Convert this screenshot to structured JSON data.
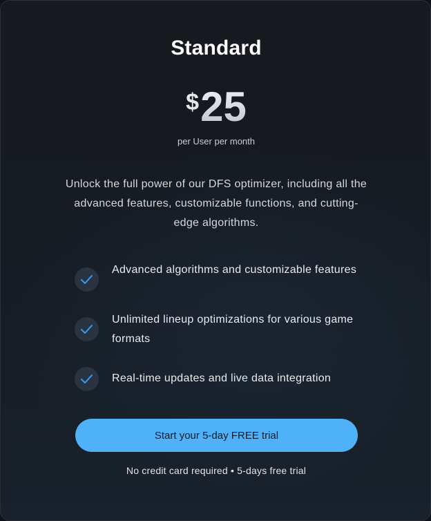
{
  "plan": {
    "title": "Standard",
    "currency": "$",
    "price": "25",
    "period": "per User per month",
    "description": "Unlock the full power of our DFS optimizer, including all the advanced features, customizable functions, and cutting-edge algorithms."
  },
  "features": [
    {
      "text": "Advanced algorithms and customizable features",
      "icon": "check-icon"
    },
    {
      "text": "Unlimited lineup optimizations for various game formats",
      "icon": "check-icon"
    },
    {
      "text": "Real-time updates and live data integration",
      "icon": "check-icon"
    }
  ],
  "cta": {
    "label": "Start your 5-day FREE trial"
  },
  "footnote": "No credit card required • 5-days free trial",
  "colors": {
    "accent": "#4fb1f7",
    "check": "#3b9bf0",
    "background": "#161b22"
  }
}
